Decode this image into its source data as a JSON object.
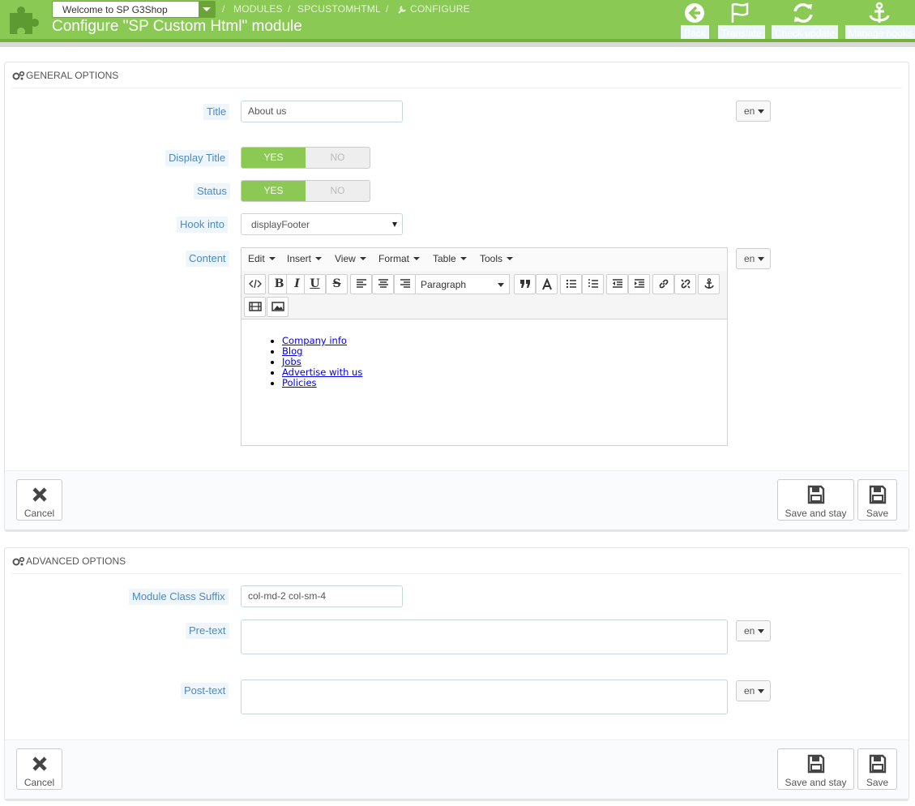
{
  "header": {
    "shop_select": "Welcome to SP G3Shop",
    "breadcrumb": [
      "MODULES",
      "SPCUSTOMHTML",
      "CONFIGURE"
    ],
    "breadcrumb_sep": "/",
    "title": "Configure \"SP Custom Html\" module",
    "toolbar": [
      {
        "label": "Back",
        "icon": "back-arrow-icon"
      },
      {
        "label": "Translate",
        "icon": "flag-icon"
      },
      {
        "label": "Check update",
        "icon": "refresh-icon"
      },
      {
        "label": "Manage hooks",
        "icon": "anchor-icon"
      }
    ],
    "accent": "#8ac954"
  },
  "general": {
    "heading": "GENERAL OPTIONS",
    "title_label": "Title",
    "title_value": "About us",
    "lang": "en",
    "display_title_label": "Display Title",
    "status_label": "Status",
    "yes": "YES",
    "no": "NO",
    "hook_label": "Hook into",
    "hook_value": "displayFooter",
    "content_label": "Content",
    "editor": {
      "menus": [
        "Edit",
        "Insert",
        "View",
        "Format",
        "Table",
        "Tools"
      ],
      "format_select": "Paragraph",
      "bold": "B",
      "italic": "I",
      "underline": "U",
      "strike": "S",
      "items": [
        "Company info",
        "Blog",
        "Jobs",
        "Advertise with us",
        "Policies"
      ]
    },
    "cancel": "Cancel",
    "save_stay": "Save and stay",
    "save": "Save"
  },
  "advanced": {
    "heading": "ADVANCED OPTIONS",
    "suffix_label": "Module Class Suffix",
    "suffix_value": "col-md-2 col-sm-4",
    "pre_label": "Pre-text",
    "post_label": "Post-text",
    "lang": "en",
    "cancel": "Cancel",
    "save_stay": "Save and stay",
    "save": "Save"
  }
}
